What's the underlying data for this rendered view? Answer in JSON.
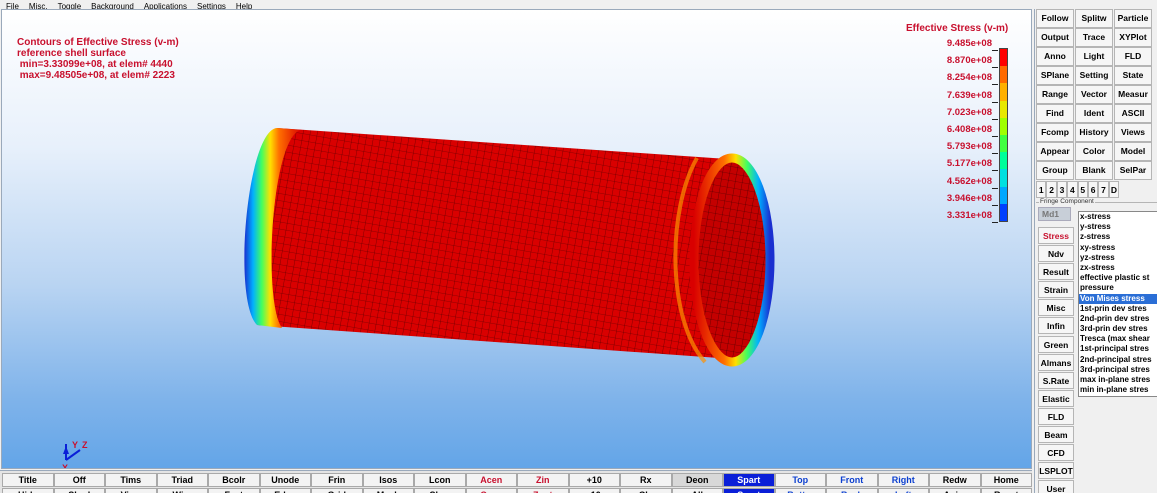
{
  "menu": [
    "File",
    "Misc.",
    "Toggle",
    "Background",
    "Applications",
    "Settings",
    "Help"
  ],
  "info": {
    "line1": "Contours of Effective Stress (v-m)",
    "line2": "reference shell surface",
    "line3": " min=3.33099e+08, at elem# 4440",
    "line4": " max=9.48505e+08, at elem# 2223"
  },
  "fringe": {
    "title": "Effective Stress (v-m)",
    "labels": [
      "9.485e+08",
      "8.870e+08",
      "8.254e+08",
      "7.639e+08",
      "7.023e+08",
      "6.408e+08",
      "5.793e+08",
      "5.177e+08",
      "4.562e+08",
      "3.946e+08",
      "3.331e+08"
    ],
    "colors": [
      "#ff0000",
      "#ff6a00",
      "#ffb000",
      "#e8e800",
      "#a0ff00",
      "#40ff40",
      "#00ff9a",
      "#00e0e0",
      "#00a8ff",
      "#0040ff"
    ]
  },
  "triad": {
    "y": "Y",
    "z": "Z",
    "x": "X"
  },
  "bottom_row1": [
    {
      "label": "Title"
    },
    {
      "label": "Off"
    },
    {
      "label": "Tims"
    },
    {
      "label": "Triad"
    },
    {
      "label": "Bcolr"
    },
    {
      "label": "Unode"
    },
    {
      "label": "Frin"
    },
    {
      "label": "Isos"
    },
    {
      "label": "Lcon"
    },
    {
      "label": "Acen",
      "style": "red"
    },
    {
      "label": "Zin",
      "style": "red"
    },
    {
      "label": "+10"
    },
    {
      "label": "Rx"
    },
    {
      "label": "Deon",
      "style": "gray"
    },
    {
      "label": "Spart",
      "style": "sel"
    },
    {
      "label": "Top",
      "style": "blue"
    },
    {
      "label": "Front",
      "style": "blue"
    },
    {
      "label": "Right",
      "style": "blue"
    },
    {
      "label": "Redw"
    },
    {
      "label": "Home"
    }
  ],
  "bottom_row2": [
    {
      "label": "Hide"
    },
    {
      "label": "Shad"
    },
    {
      "label": "View"
    },
    {
      "label": "Wire"
    },
    {
      "label": "Feat"
    },
    {
      "label": "Edge"
    },
    {
      "label": "Grid"
    },
    {
      "label": "Mesh"
    },
    {
      "label": "Shrn"
    },
    {
      "label": "Ccen",
      "style": "red"
    },
    {
      "label": "Zout",
      "style": "red"
    },
    {
      "label": "-10"
    },
    {
      "label": "Cls"
    },
    {
      "label": "All"
    },
    {
      "label": "Spart",
      "style": "sel"
    },
    {
      "label": "Bottm",
      "style": "blue"
    },
    {
      "label": "Back",
      "style": "blue"
    },
    {
      "label": "Left",
      "style": "blue"
    },
    {
      "label": "Anim"
    },
    {
      "label": "Reset"
    }
  ],
  "right_buttons": [
    "Follow",
    "Splitw",
    "Particle",
    "Output",
    "Trace",
    "XYPlot",
    "Anno",
    "Light",
    "FLD",
    "SPlane",
    "Setting",
    "State",
    "Range",
    "Vector",
    "Measur",
    "Find",
    "Ident",
    "ASCII",
    "Fcomp",
    "History",
    "Views",
    "Appear",
    "Color",
    "Model",
    "Group",
    "Blank",
    "SelPar"
  ],
  "num_buttons": [
    "1",
    "2",
    "3",
    "4",
    "5",
    "6",
    "7",
    "D"
  ],
  "fringe_component": {
    "label": "Fringe Component",
    "md1": "Md1",
    "categories": [
      {
        "label": "Stress",
        "style": "red"
      },
      {
        "label": "Ndv"
      },
      {
        "label": "Result"
      },
      {
        "label": "Strain"
      },
      {
        "label": "Misc"
      },
      {
        "label": "Infin"
      },
      {
        "label": "Green"
      },
      {
        "label": "Almans"
      },
      {
        "label": "S.Rate"
      },
      {
        "label": "Elastic"
      },
      {
        "label": "FLD"
      },
      {
        "label": "Beam"
      },
      {
        "label": "CFD"
      },
      {
        "label": "LSPLOT"
      },
      {
        "label": "User"
      }
    ],
    "items": [
      "x-stress",
      "y-stress",
      "z-stress",
      "xy-stress",
      "yz-stress",
      "zx-stress",
      "effective plastic st",
      "pressure",
      "Von Mises stress",
      "1st-prin dev stres",
      "2nd-prin dev stres",
      "3rd-prin dev stres",
      "Tresca (max shear",
      "1st-principal stres",
      "2nd-principal stres",
      "3rd-principal stres",
      "max in-plane stres",
      "min in-plane stres"
    ],
    "selected_index": 8
  }
}
